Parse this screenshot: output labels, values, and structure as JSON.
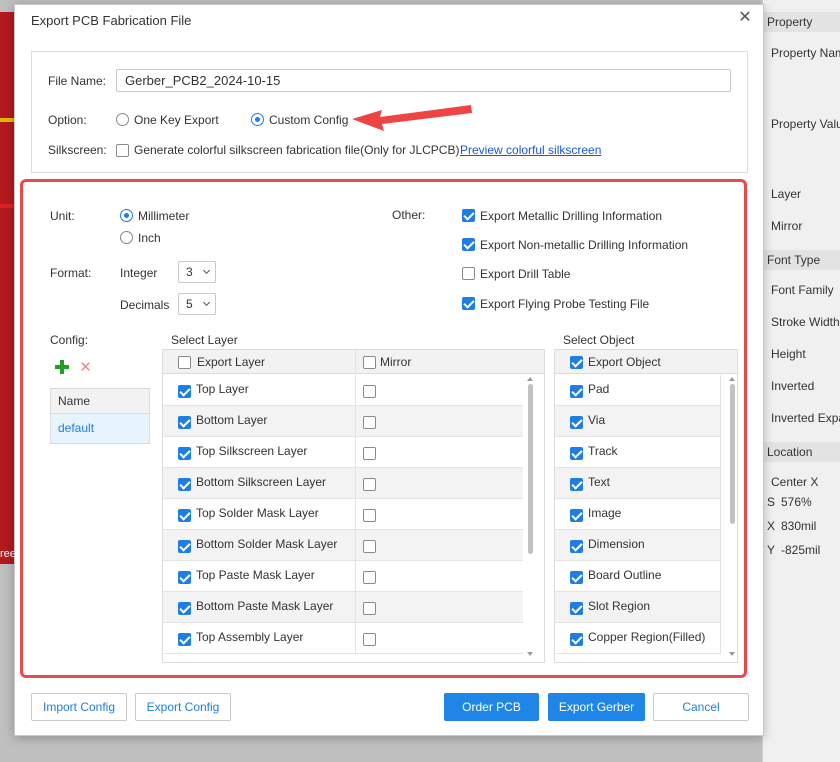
{
  "background": {
    "editor_partial_label": "ree",
    "property_panel": [
      {
        "label": "Property",
        "type": "header"
      },
      {
        "label": "Property Nam",
        "type": "row"
      },
      {
        "label": "Property Valu",
        "type": "row"
      },
      {
        "label": "Layer",
        "type": "row"
      },
      {
        "label": "Mirror",
        "type": "row"
      },
      {
        "label": "Font Type",
        "type": "header"
      },
      {
        "label": "Font Family",
        "type": "row"
      },
      {
        "label": "Stroke Width",
        "type": "row"
      },
      {
        "label": "Height",
        "type": "row"
      },
      {
        "label": "Inverted",
        "type": "row"
      },
      {
        "label": "Inverted Expa",
        "type": "row"
      },
      {
        "label": "Location",
        "type": "header"
      },
      {
        "label": "Center X",
        "type": "row"
      },
      {
        "label": "576%",
        "prefix": "S",
        "type": "row"
      },
      {
        "label": "830mil",
        "prefix": "X",
        "type": "row"
      },
      {
        "label": "-825mil",
        "prefix": "Y",
        "type": "row"
      }
    ]
  },
  "dialog": {
    "title": "Export PCB Fabrication File",
    "close_icon": "close-icon",
    "file_name_label": "File Name:",
    "file_name_value": "Gerber_PCB2_2024-10-15",
    "option_label": "Option:",
    "option_one_key": "One Key Export",
    "option_custom": "Custom Config",
    "option_selected": "Custom Config",
    "silkscreen_label": "Silkscreen:",
    "silkscreen_checkbox_text": "Generate colorful silkscreen fabrication file(Only for JLCPCB)",
    "silkscreen_checked": false,
    "preview_link": "Preview colorful silkscreen",
    "highlight_color": "#e74c4c",
    "accent_color": "#1f7ee3"
  },
  "config": {
    "unit_label": "Unit:",
    "unit_mm": "Millimeter",
    "unit_inch": "Inch",
    "unit_selected": "Millimeter",
    "format_label": "Format:",
    "integer_label": "Integer",
    "integer_value": "3",
    "decimals_label": "Decimals",
    "decimals_value": "5",
    "other_label": "Other:",
    "other_options": [
      {
        "label": "Export Metallic Drilling Information",
        "checked": true
      },
      {
        "label": "Export Non-metallic Drilling Information",
        "checked": true
      },
      {
        "label": "Export Drill Table",
        "checked": false
      },
      {
        "label": "Export Flying Probe Testing File",
        "checked": true
      }
    ],
    "config_label": "Config:",
    "add_icon": "plus-icon",
    "delete_icon": "delete-icon",
    "config_table_header": "Name",
    "config_table_rows": [
      "default"
    ],
    "select_layer_title": "Select Layer",
    "layer_col_export": "Export Layer",
    "layer_col_mirror": "Mirror",
    "layers": [
      {
        "name": "Top Layer",
        "export": true,
        "mirror": false
      },
      {
        "name": "Bottom Layer",
        "export": true,
        "mirror": false
      },
      {
        "name": "Top Silkscreen Layer",
        "export": true,
        "mirror": false
      },
      {
        "name": "Bottom Silkscreen Layer",
        "export": true,
        "mirror": false
      },
      {
        "name": "Top Solder Mask Layer",
        "export": true,
        "mirror": false
      },
      {
        "name": "Bottom Solder Mask Layer",
        "export": true,
        "mirror": false
      },
      {
        "name": "Top Paste Mask Layer",
        "export": true,
        "mirror": false
      },
      {
        "name": "Bottom Paste Mask Layer",
        "export": true,
        "mirror": false
      },
      {
        "name": "Top Assembly Layer",
        "export": true,
        "mirror": false
      }
    ],
    "select_object_title": "Select Object",
    "object_col_export": "Export Object",
    "objects": [
      {
        "name": "Pad",
        "checked": true
      },
      {
        "name": "Via",
        "checked": true
      },
      {
        "name": "Track",
        "checked": true
      },
      {
        "name": "Text",
        "checked": true
      },
      {
        "name": "Image",
        "checked": true
      },
      {
        "name": "Dimension",
        "checked": true
      },
      {
        "name": "Board Outline",
        "checked": true
      },
      {
        "name": "Slot Region",
        "checked": true
      },
      {
        "name": "Copper Region(Filled)",
        "checked": true
      }
    ]
  },
  "buttons": {
    "import_config": "Import Config",
    "export_config": "Export Config",
    "order_pcb": "Order PCB",
    "export_gerber": "Export Gerber",
    "cancel": "Cancel"
  }
}
